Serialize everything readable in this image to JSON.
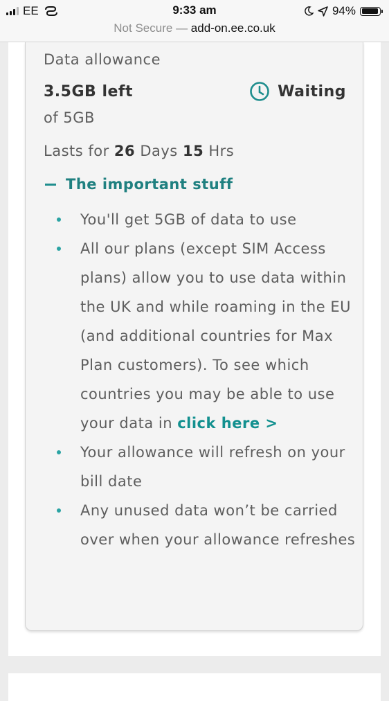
{
  "status_bar": {
    "carrier": "EE",
    "time": "9:33 am",
    "battery": "94%",
    "battery_level": 0.94,
    "icons": [
      "signal-icon",
      "link-icon",
      "moon-icon",
      "location-arrow-icon",
      "battery-icon"
    ]
  },
  "url_bar": {
    "security": "Not Secure",
    "separator": "—",
    "domain": "add-on.ee.co.uk"
  },
  "allowance": {
    "label": "Data allowance",
    "remaining": "3.5GB left",
    "total": "of 5GB",
    "status": "Waiting",
    "status_icon": "clock-icon",
    "lasts_prefix": "Lasts for",
    "days": "26",
    "days_label": "Days",
    "hours": "15",
    "hours_label": "Hrs"
  },
  "important": {
    "title": "The important stuff",
    "toggle_icon": "minus-icon",
    "items": [
      {
        "text": "You'll get 5GB of data to use"
      },
      {
        "text": "All our plans (except SIM Access plans) allow you to use data within the UK and while roaming in the EU (and additional countries for Max Plan customers). To see which countries you may be able to use your data in",
        "link": "click here >"
      },
      {
        "text": "Your allowance will refresh on your bill date"
      },
      {
        "text": "Any unused data won’t be carried over when your allowance refreshes"
      }
    ]
  },
  "colors": {
    "accent": "#1f8e8e",
    "text": "#5d5d5d",
    "strong_text": "#333333",
    "card_bg": "#f4f4f4",
    "page_bg": "#ececec"
  }
}
